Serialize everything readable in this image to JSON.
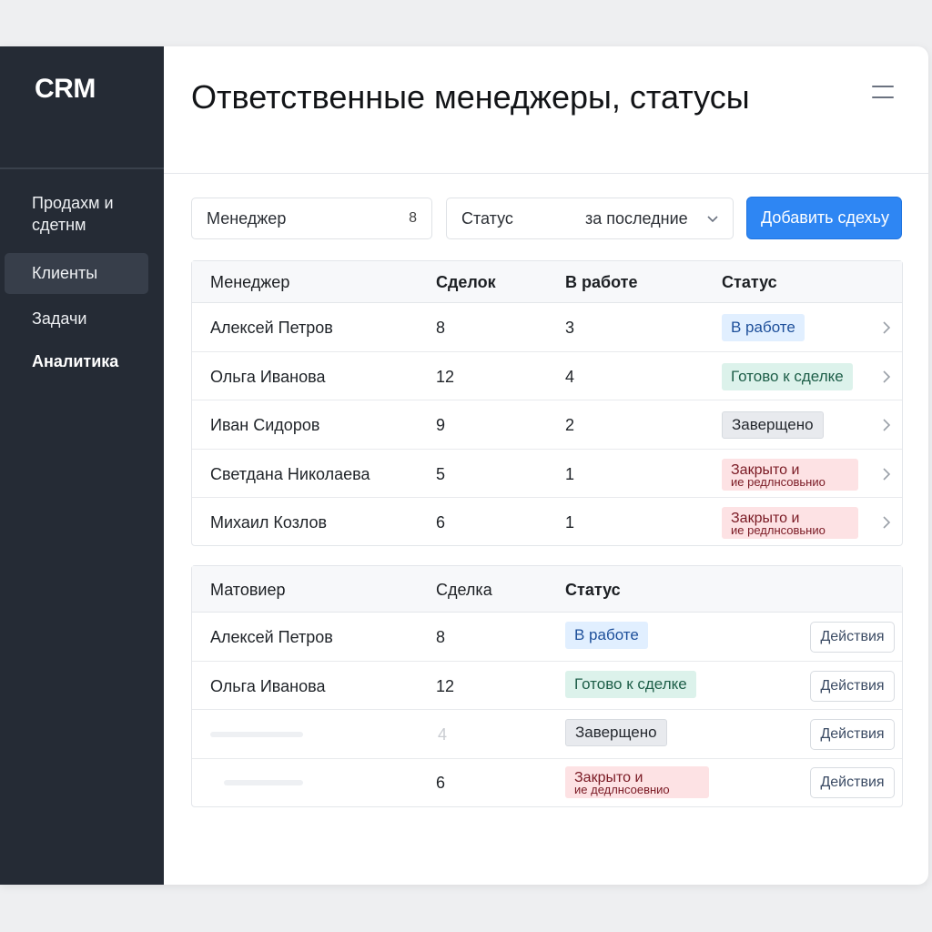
{
  "app": {
    "logo": "CRM"
  },
  "sidebar": {
    "items": [
      {
        "label": "Продахм и сдетнм"
      },
      {
        "label": "Клиенты"
      },
      {
        "label": "Задачи"
      },
      {
        "label": "Аналитика"
      }
    ]
  },
  "header": {
    "title": "Ответственные менеджеры, статусы"
  },
  "filters": {
    "manager": {
      "label": "Менеджер",
      "count": "8"
    },
    "status": {
      "label": "Статус",
      "period": "за последние"
    },
    "add_button": "Добавить сдехьу"
  },
  "colors": {
    "accent": "#2e86f3",
    "sidebar": "#252b35",
    "status_blue": "#e1efff",
    "status_green": "#dcf2eb",
    "status_gray": "#e8eaee",
    "status_red": "#fde2e4"
  },
  "table1": {
    "headers": [
      "Менеджер",
      "Сделок",
      "В работе",
      "Статус"
    ],
    "rows": [
      {
        "name": "Алексей Петров",
        "deals": "8",
        "in_work": "3",
        "status": "В работе",
        "status_line2": "",
        "status_color": "blue"
      },
      {
        "name": "Ольга Иванова",
        "deals": "12",
        "in_work": "4",
        "status": "Готово к сделке",
        "status_line2": "",
        "status_color": "green"
      },
      {
        "name": "Иван Сидоров",
        "deals": "9",
        "in_work": "2",
        "status": "Заверщено",
        "status_line2": "",
        "status_color": "gray"
      },
      {
        "name": "Светдана Николаева",
        "deals": "5",
        "in_work": "1",
        "status": "Закрыто и",
        "status_line2": "ие редлнсовьнио",
        "status_color": "red"
      },
      {
        "name": "Михаил Козлов",
        "deals": "6",
        "in_work": "1",
        "status": "Закрыто и",
        "status_line2": "ие редлнсовьнио",
        "status_color": "red"
      }
    ]
  },
  "table2": {
    "headers": [
      "Матовиер",
      "Сделка",
      "Статус"
    ],
    "action_label": "Действия",
    "rows": [
      {
        "name": "Алексей Петров",
        "deals": "8",
        "status": "В работе",
        "status_line2": "",
        "status_color": "blue"
      },
      {
        "name": "Ольга Иванова",
        "deals": "12",
        "status": "Готово к сделке",
        "status_line2": "",
        "status_color": "green"
      },
      {
        "name": "",
        "deals": "4",
        "status": "Заверщено",
        "status_line2": "",
        "status_color": "gray"
      },
      {
        "name": "",
        "deals": "6",
        "status": "Закрыто и",
        "status_line2": "ие дедлнсоевнио",
        "status_color": "red"
      }
    ]
  }
}
